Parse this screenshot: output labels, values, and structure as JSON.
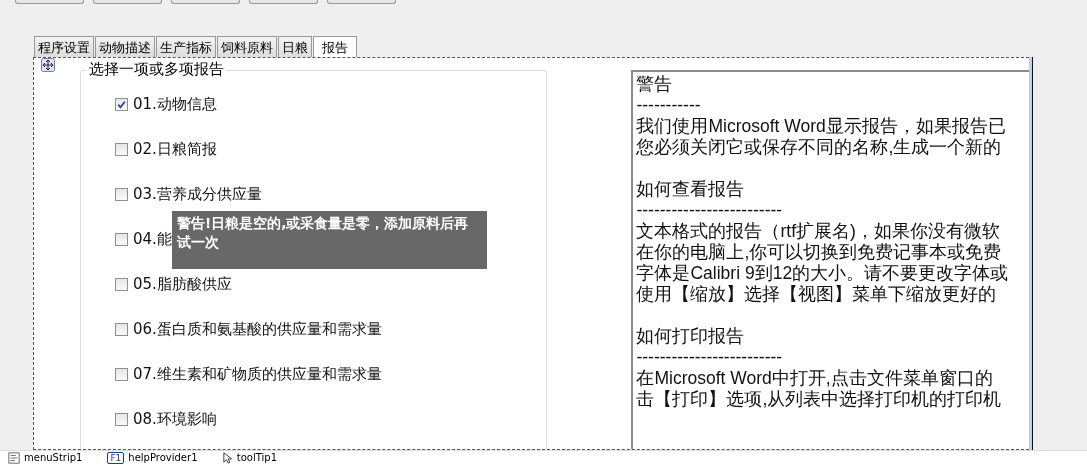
{
  "tabs": [
    {
      "label": "程序设置",
      "selected": false
    },
    {
      "label": "动物描述",
      "selected": false
    },
    {
      "label": "生产指标",
      "selected": false
    },
    {
      "label": "饲料原料",
      "selected": false
    },
    {
      "label": "日粮",
      "selected": false
    },
    {
      "label": "报告",
      "selected": true
    }
  ],
  "report_group": {
    "title": "选择一项或多项报告",
    "options": [
      {
        "label": "01.动物信息",
        "checked": true
      },
      {
        "label": "02.日粮简报",
        "checked": false
      },
      {
        "label": "03.营养成分供应量",
        "checked": false
      },
      {
        "label": "04.能",
        "checked": false
      },
      {
        "label": "05.脂肪酸供应",
        "checked": false
      },
      {
        "label": "06.蛋白质和氨基酸的供应量和需求量",
        "checked": false
      },
      {
        "label": "07.维生素和矿物质的供应量和需求量",
        "checked": false
      },
      {
        "label": "08.环境影响",
        "checked": false
      }
    ]
  },
  "tooltip": {
    "text": "警告!日粮是空的,或采食量是零，添加原料后再试一次"
  },
  "info_sections": [
    {
      "lines": [
        "警告",
        "-----------",
        "我们使用Microsoft Word显示报告，如果报告已",
        "您必须关闭它或保存不同的名称,生成一个新的"
      ]
    },
    {
      "lines": [
        "如何查看报告",
        "-------------------------",
        "文本格式的报告（rtf扩展名)，如果你没有微软",
        "在你的电脑上,你可以切换到免费记事本或免费",
        "字体是Calibri 9到12的大小。请不要更改字体或",
        "使用【缩放】选择【视图】菜单下缩放更好的"
      ]
    },
    {
      "lines": [
        "如何打印报告",
        "-------------------------",
        "在Microsoft Word中打开,点击文件菜单窗口的",
        "击【打印】选项,从列表中选择打印机的打印机"
      ]
    }
  ],
  "component_tray": [
    {
      "kind": "menu",
      "label": "menuStrip1"
    },
    {
      "kind": "help",
      "icon_text": "F1",
      "label": "helpProvider1"
    },
    {
      "kind": "tooltip",
      "label": "toolTip1"
    }
  ]
}
